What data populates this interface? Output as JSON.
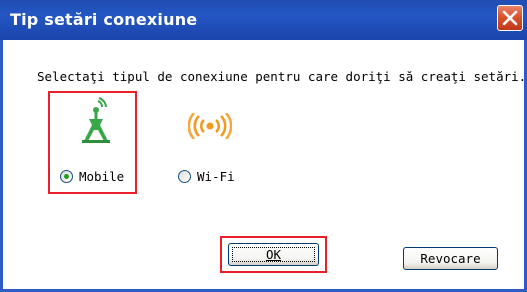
{
  "window": {
    "title": "Tip setări conexiune",
    "close_icon": "close-icon"
  },
  "dialog": {
    "instruction": "Selectaţi tipul de conexiune pentru care doriţi să creaţi setări.",
    "options": [
      {
        "label": "Mobile",
        "selected": true,
        "icon": "mobile-antenna-icon"
      },
      {
        "label": "Wi-Fi",
        "selected": false,
        "icon": "wifi-icon"
      }
    ]
  },
  "buttons": {
    "ok_label": "OK",
    "cancel_label": "Revocare"
  },
  "colors": {
    "titlebar": "#2456c4",
    "highlight": "#e8202a",
    "mobile_icon": "#3aa64a",
    "wifi_icon": "#f29a1f"
  }
}
